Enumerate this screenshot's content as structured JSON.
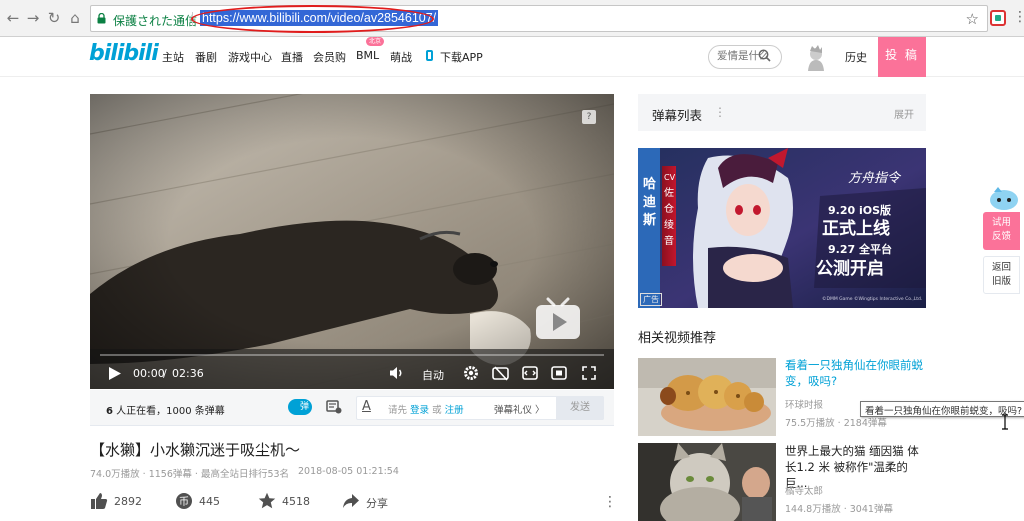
{
  "browser": {
    "secure_label": "保護された通信",
    "url": "https://www.bilibili.com/video/av28546107/"
  },
  "header": {
    "logo": "bilibili",
    "nav": [
      "主站",
      "番剧",
      "游戏中心",
      "直播",
      "会员购",
      "BML",
      "萌战",
      "下载APP"
    ],
    "bml_badge": "北京",
    "search_placeholder": "爱情是什么",
    "history": "历史",
    "upload": "投 稿",
    "accent": "#fb7299",
    "brand": "#00a1d6"
  },
  "player": {
    "time_current": "00:00",
    "time_sep": "/",
    "time_total": "02:36",
    "quality": "自动",
    "help": "?",
    "progress": 0
  },
  "danmaku_bar": {
    "viewers": "6",
    "viewers_text": " 人正在看，",
    "danmaku_count": "1000",
    "danmaku_text": " 条弹幕",
    "toggle_label": "弹",
    "font_icon": "A",
    "prompt_pre": "请先",
    "login": "登录",
    "or": "或",
    "register": "注册",
    "etiquette": "弹幕礼仪 〉",
    "send": "发送"
  },
  "video": {
    "title": "【水獭】小水獭沉迷于吸尘机～",
    "meta": "74.0万播放 · 1156弹幕 · 最高全站日排行53名",
    "date": "2018-08-05 01:21:54",
    "likes": "2892",
    "coins": "445",
    "favorites": "4518",
    "share": "分享"
  },
  "danmaku_list": {
    "title": "弹幕列表",
    "menu": "⋮",
    "expand": "展开"
  },
  "ad": {
    "label": "广告",
    "left_text": [
      "哈",
      "迪",
      "斯"
    ],
    "cv_text": [
      "CV",
      "佐",
      "仓",
      "绫",
      "音"
    ],
    "game_title": "方舟指令",
    "line1": "9.20 iOS版",
    "line2": "正式上线",
    "line3": "9.27 全平台",
    "line4": "公测开启",
    "footer": "©DMM Game ©Wingtips Interactive Co.,Ltd."
  },
  "related": {
    "title": "相关视频推荐",
    "items": [
      {
        "title": "看着一只独角仙在你眼前蜕变，吸吗?",
        "up": "环球时报",
        "plays": "75.5万播放",
        "danmaku": "2184弹幕"
      },
      {
        "title": "世界上最大的猫 缅因猫 体长1.2 米 被称作\"温柔的巨...",
        "up": "橘寺太郎",
        "plays": "144.8万播放",
        "danmaku": "3041弹幕"
      }
    ],
    "tooltip": "看着一只独角仙在你眼前蜕变，吸吗?"
  },
  "side": {
    "feedback": "试用\n反馈",
    "old_version": "返回\n旧版"
  }
}
